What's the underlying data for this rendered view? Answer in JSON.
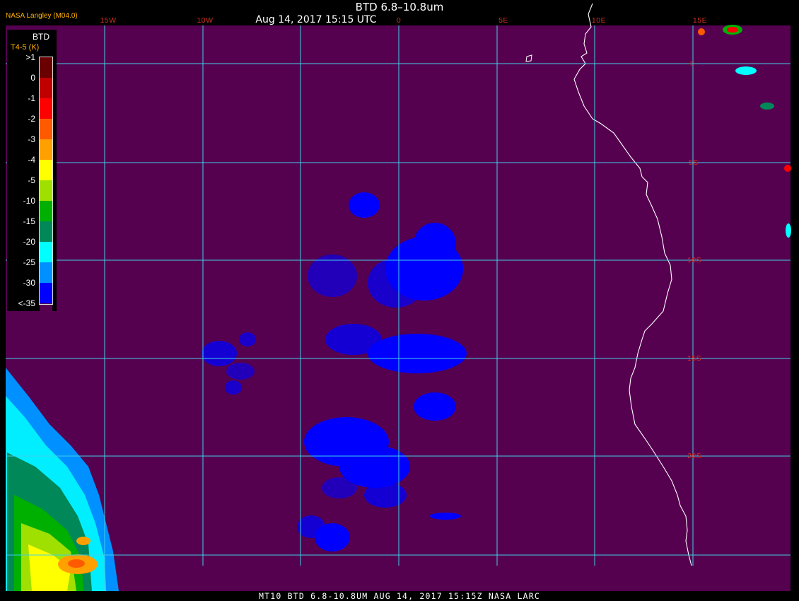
{
  "header": {
    "producer": "NASA Langley (M04.0)",
    "title": "BTD 6.8–10.8um",
    "datetime": "Aug 14, 2017 15:15 UTC"
  },
  "footer": {
    "caption": "MT10   BTD 6.8-10.8UM   AUG 14, 2017 15:15Z   NASA LARC"
  },
  "longitude_labels": [
    "15W",
    "10W",
    "0",
    "5E",
    "10E",
    "15E"
  ],
  "latitude_labels": [
    "0",
    "5S",
    "10S",
    "15S",
    "20S"
  ],
  "legend": {
    "title": "BTD",
    "units": "T4-5 (K)",
    "labels": [
      ">1",
      "0",
      "-1",
      "-2",
      "-3",
      "-4",
      "-5",
      "-10",
      "-15",
      "-20",
      "-25",
      "-30",
      "<-35"
    ],
    "colors": [
      "#6b0000",
      "#c00000",
      "#ff0000",
      "#ff5a00",
      "#ffa000",
      "#ffff00",
      "#a0e000",
      "#00b000",
      "#008858",
      "#00ffff",
      "#0090ff",
      "#0000ff",
      "#560050"
    ]
  },
  "colors": {
    "background": "#560050",
    "grid": "#40d0e8",
    "coastline": "#ffffff",
    "cloud_blue": "#0000ff",
    "label_red": "#d03020"
  }
}
